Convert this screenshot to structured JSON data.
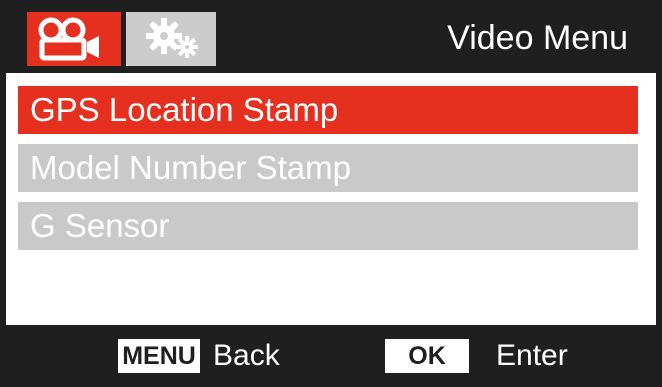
{
  "header": {
    "title": "Video Menu",
    "active_tab_icon": "video-camera-icon",
    "inactive_tab_icon": "gears-icon",
    "active_tab_color": "#e5301f",
    "inactive_tab_color": "#cccccc"
  },
  "menu": {
    "items": [
      {
        "label": "GPS Location Stamp",
        "selected": true
      },
      {
        "label": "Model Number Stamp",
        "selected": false
      },
      {
        "label": "G Sensor",
        "selected": false
      }
    ],
    "selected_color": "#e5301f",
    "unselected_color": "#c9c9c9"
  },
  "footer": {
    "menu_key": "MENU",
    "menu_action": "Back",
    "ok_key": "OK",
    "ok_action": "Enter"
  }
}
